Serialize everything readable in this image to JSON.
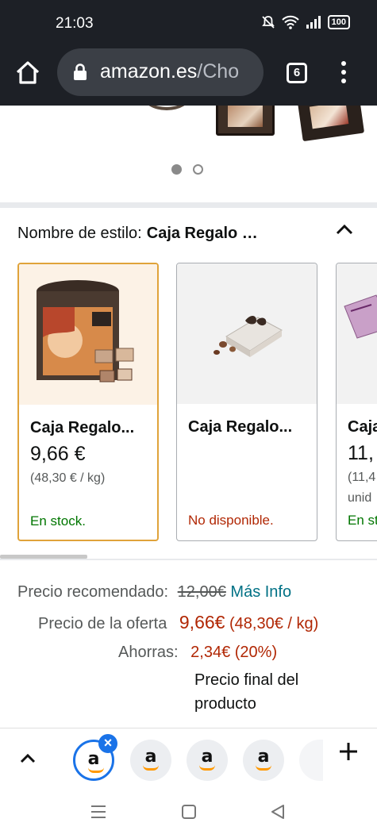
{
  "status_bar": {
    "time": "21:03",
    "battery": "100",
    "icons": [
      "mute-icon",
      "wifi-icon",
      "signal-icon",
      "battery-icon"
    ]
  },
  "browser": {
    "url_domain": "amazon.es",
    "url_path": "/Cho",
    "tab_count": "6",
    "icons": [
      "home-icon",
      "lock-icon",
      "tabs-icon",
      "menu-icon"
    ]
  },
  "carousel": {
    "dots_total": 2,
    "active_dot": 1
  },
  "style_selector": {
    "label": "Nombre de estilo:",
    "value": "Caja Regalo …",
    "options": [
      {
        "title": "Caja Regalo...",
        "price": "9,66 €",
        "unit_price": "(48,30 € / kg)",
        "unit_price_2": "",
        "stock": "En stock.",
        "selected": true
      },
      {
        "title": "Caja Regalo...",
        "price": "",
        "unit_price": "",
        "unit_price_2": "",
        "stock": "No disponible.",
        "selected": false
      },
      {
        "title": "Caja",
        "price": "11,",
        "unit_price": "(11,4",
        "unit_price_2": "unid",
        "stock": "En st",
        "selected": false
      }
    ]
  },
  "pricing": {
    "recommended_label": "Precio recomendado:",
    "recommended_value": "12,00€",
    "more_info": "Más Info",
    "offer_label": "Precio de la oferta",
    "offer_value": "9,66€",
    "offer_unit": "(48,30€ / kg)",
    "savings_label": "Ahorras:",
    "savings_value": "2,34€ (20%)",
    "final_line_1": "Precio final del",
    "final_line_2": "producto"
  },
  "tab_strip": {
    "favicon_letter": "a",
    "close_glyph": "×",
    "add_glyph": "+"
  },
  "colors": {
    "in_stock": "#007600",
    "unavailable": "#B12704",
    "selected_border": "#E0A33A",
    "link": "#007185",
    "active_tab": "#1A73E8"
  }
}
